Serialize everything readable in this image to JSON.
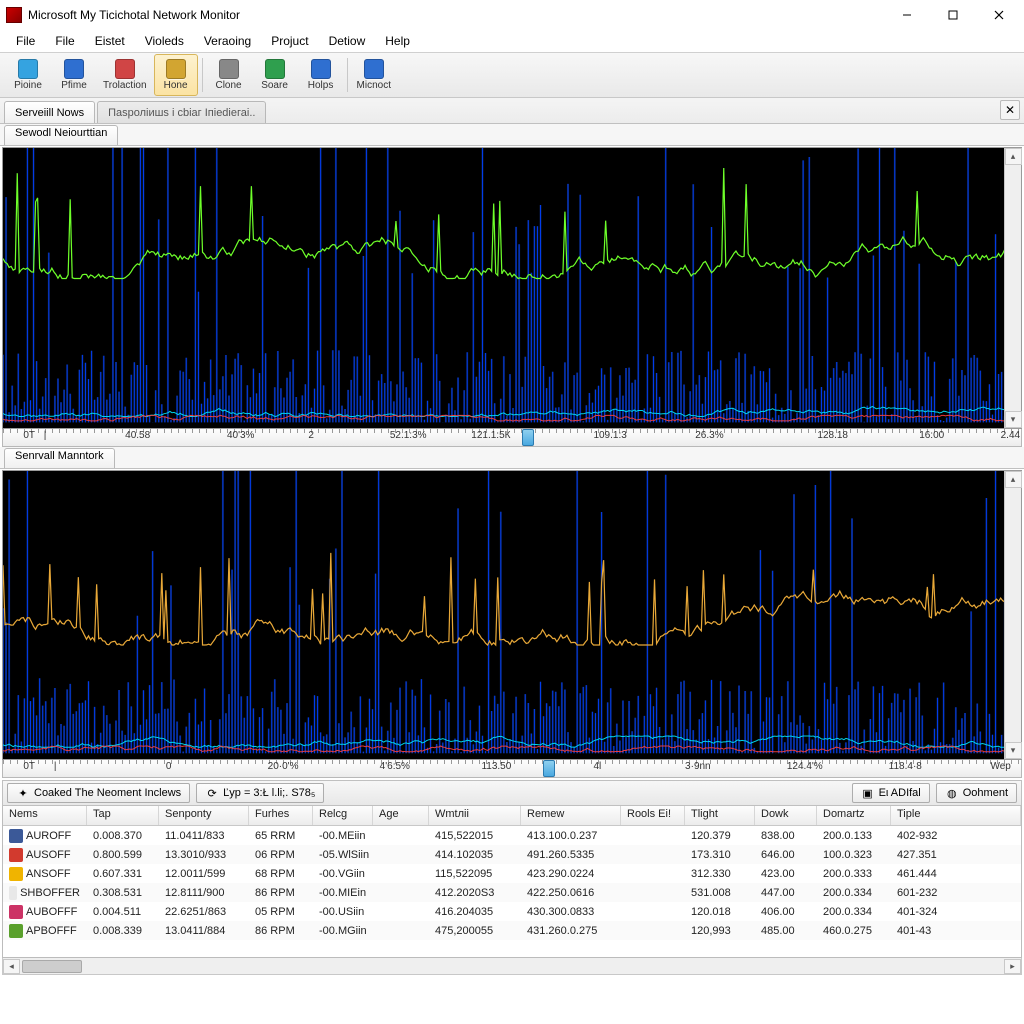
{
  "window": {
    "title": "Microsoft My Ticichotal Network Monitor"
  },
  "menu": [
    "File",
    "File",
    "Eistet",
    "Violeds",
    "Veraoing",
    "Projuct",
    "Detiow",
    "Help"
  ],
  "toolbar": [
    {
      "label": "Pioine",
      "icon": "droplet-icon",
      "color": "#35a3e0"
    },
    {
      "label": "Pfime",
      "icon": "doc-icon",
      "color": "#2f6fd0"
    },
    {
      "label": "Trolaction",
      "icon": "calendar-icon",
      "color": "#d04545"
    },
    {
      "label": "Hone",
      "icon": "home-icon",
      "color": "#d2a531",
      "active": true
    },
    {
      "label": "Clone",
      "icon": "clock-icon",
      "color": "#888"
    },
    {
      "label": "Soare",
      "icon": "share-icon",
      "color": "#2f9f4e"
    },
    {
      "label": "Holps",
      "icon": "help-icon",
      "color": "#2f6fd0"
    },
    {
      "label": "Micnoct",
      "icon": "window-icon",
      "color": "#2f6fd0"
    }
  ],
  "doc_tabs": [
    {
      "label": "Serveiill Nows",
      "active": true
    },
    {
      "label": "Паsроліишs і сbіaг Іпіеdіегаі..",
      "active": false
    }
  ],
  "panel1": {
    "tab": "Sewodl Neiourttian",
    "axis_ticks": [
      {
        "pos": 2,
        "text": "0T"
      },
      {
        "pos": 4,
        "text": "|"
      },
      {
        "pos": 12,
        "text": "40.58"
      },
      {
        "pos": 22,
        "text": "40'3%"
      },
      {
        "pos": 30,
        "text": "2"
      },
      {
        "pos": 38,
        "text": "52.1:3%"
      },
      {
        "pos": 46,
        "text": "121.1:5К"
      },
      {
        "pos": 58,
        "text": "109.1:3"
      },
      {
        "pos": 68,
        "text": "26.3%"
      },
      {
        "pos": 80,
        "text": "128.18"
      },
      {
        "pos": 90,
        "text": "16:00"
      },
      {
        "pos": 98,
        "text": "2.44"
      }
    ],
    "marker_pos": 51
  },
  "panel2": {
    "tab": "Senrvall Manntork",
    "axis_ticks": [
      {
        "pos": 2,
        "text": "0T"
      },
      {
        "pos": 5,
        "text": "|"
      },
      {
        "pos": 16,
        "text": "0"
      },
      {
        "pos": 26,
        "text": "20·0'%"
      },
      {
        "pos": 37,
        "text": "4'6:5%"
      },
      {
        "pos": 47,
        "text": "113.50"
      },
      {
        "pos": 58,
        "text": "4l"
      },
      {
        "pos": 67,
        "text": "3·9nn"
      },
      {
        "pos": 77,
        "text": "124.4'%"
      },
      {
        "pos": 87,
        "text": "118.4·8"
      },
      {
        "pos": 97,
        "text": "Wep"
      }
    ],
    "marker_pos": 53
  },
  "filterbar": {
    "btn1": "Coaked The Neoment Inclews",
    "btn2": "Ľyp = 3:Ł l.li;. S78₅",
    "btn_add": "Ει ΑDIfal",
    "btn_comment": "Oohment"
  },
  "columns": [
    "Nems",
    "Tap",
    "Senponty",
    "Furhes",
    "Relcg",
    "Age",
    "Wmtлii",
    "Remew",
    "Rools Ei!",
    "Tlight",
    "Dowk",
    "Domartz",
    "Tiple"
  ],
  "rows": [
    {
      "ico": "#3b5998",
      "cells": [
        "AUROFF",
        "0.008.370",
        "11.0411/833",
        "65 RRM",
        "-00.MEiin",
        "",
        "415,522015",
        "413.100.0.237",
        "",
        "120.379",
        "838.00",
        "200.0.133",
        "402-932"
      ]
    },
    {
      "ico": "#d23a2e",
      "cells": [
        "AUSOFF",
        "0.800.599",
        "13.3010/933",
        "06 RPM",
        "-05.WlSiin",
        "",
        "414.102035",
        "491.260.5335",
        "",
        "173.310",
        "646.00",
        "100.0.323",
        "427.351"
      ]
    },
    {
      "ico": "#f0b400",
      "cells": [
        "ANSOFF",
        "0.607.331",
        "12.0011/599",
        "68 RPM",
        "-00.VGiin",
        "",
        "115,522095",
        "423.290.0224",
        "",
        "312.330",
        "423.00",
        "200.0.333",
        "461.444"
      ]
    },
    {
      "ico": "#e8e8e8",
      "cells": [
        "SHBOFFER",
        "0.308.531",
        "12.8111/900",
        "86 RPM",
        "-00.MIEin",
        "",
        "412.2020S3",
        "422.250.0616",
        "",
        "531.008",
        "447.00",
        "200.0.334",
        "601-232"
      ]
    },
    {
      "ico": "#cc3366",
      "cells": [
        "AUBOFFF",
        "0.004.511",
        "22.6251/863",
        "05 RPM",
        "-00.USiin",
        "",
        "416.204035",
        "430.300.0833",
        "",
        "120.018",
        "406.00",
        "200.0.334",
        "401-324"
      ]
    },
    {
      "ico": "#5aa02c",
      "cells": [
        "APBOFFF",
        "0.008.339",
        "13.0411/884",
        "86 RPM",
        "-00.MGiin",
        "",
        "475,200055",
        "431.260.0.275",
        "",
        "120,993",
        "485.00",
        "460.0.275",
        "401-43"
      ]
    }
  ],
  "chart_data": [
    {
      "type": "line",
      "title": "Sewodl Neiourttian",
      "series": [
        {
          "name": "green-trace",
          "color": "#6eff2a",
          "baseline": 0.4,
          "amp": 0.22
        },
        {
          "name": "blue-spikes",
          "color": "#0040ff",
          "baseline": 0.92,
          "amp": 0.55
        },
        {
          "name": "cyan-floor",
          "color": "#00e8ff",
          "baseline": 0.95,
          "amp": 0.03
        },
        {
          "name": "red-floor",
          "color": "#ff4040",
          "baseline": 0.97,
          "amp": 0.015
        }
      ],
      "x_ticks_pct": [
        2,
        4,
        12,
        22,
        30,
        38,
        46,
        58,
        68,
        80,
        90,
        98
      ],
      "x_tick_labels": [
        "0T",
        "|",
        "40.58",
        "40'3%",
        "2",
        "52.1:3%",
        "121.1:5К",
        "109.1:3",
        "26.3%",
        "128.18",
        "16:00",
        "2.44"
      ]
    },
    {
      "type": "line",
      "title": "Senrvall Manntork",
      "series": [
        {
          "name": "orange-trace",
          "color": "#e8a838",
          "baseline": 0.55,
          "amp": 0.18
        },
        {
          "name": "blue-spikes",
          "color": "#0040ff",
          "baseline": 0.92,
          "amp": 0.5
        },
        {
          "name": "cyan-floor",
          "color": "#00e8ff",
          "baseline": 0.95,
          "amp": 0.03
        },
        {
          "name": "red-floor",
          "color": "#ff4040",
          "baseline": 0.97,
          "amp": 0.015
        }
      ],
      "x_ticks_pct": [
        2,
        5,
        16,
        26,
        37,
        47,
        58,
        67,
        77,
        87,
        97
      ],
      "x_tick_labels": [
        "0T",
        "|",
        "0",
        "20·0'%",
        "4'6:5%",
        "113.50",
        "4l",
        "3·9nn",
        "124.4'%",
        "118.4·8",
        "Wep"
      ]
    }
  ]
}
